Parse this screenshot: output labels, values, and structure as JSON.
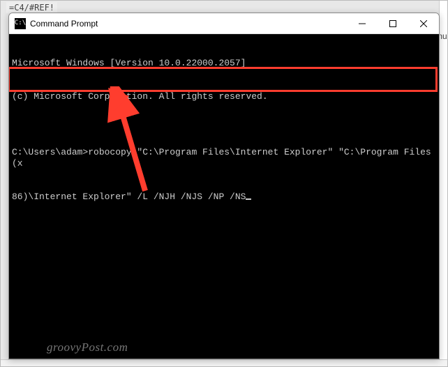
{
  "background": {
    "tab_label": "=C4/#REF!",
    "right_fragment": "nu"
  },
  "window": {
    "title": "Command Prompt",
    "icon_text": "C:\\",
    "buttons": {
      "minimize": "minimize",
      "maximize": "maximize",
      "close": "close"
    }
  },
  "terminal": {
    "line1": "Microsoft Windows [Version 10.0.22000.2057]",
    "line2": "(c) Microsoft Corporation. All rights reserved.",
    "blank": "",
    "prompt_line1": "C:\\Users\\adam>robocopy \"C:\\Program Files\\Internet Explorer\" \"C:\\Program Files (x",
    "prompt_line2": "86)\\Internet Explorer\" /L /NJH /NJS /NP /NS"
  },
  "annotation": {
    "highlight_color": "#ff3d2e"
  },
  "watermark": "groovyPost.com"
}
